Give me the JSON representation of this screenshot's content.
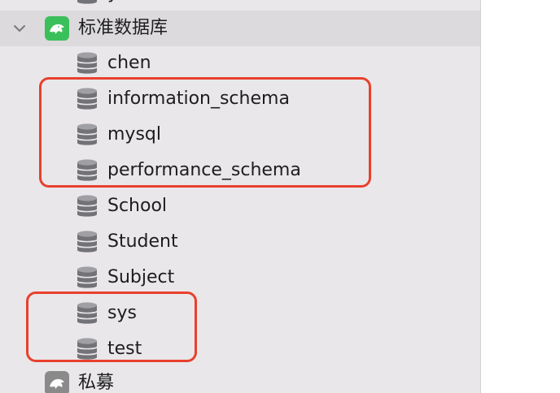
{
  "top_partial_label": "y",
  "connection": {
    "name": "标准数据库",
    "icon": "mysql-dolphin-icon",
    "expanded": true,
    "icon_color": "#3bbf5a"
  },
  "databases": [
    {
      "name": "chen"
    },
    {
      "name": "information_schema"
    },
    {
      "name": "mysql"
    },
    {
      "name": "performance_schema"
    },
    {
      "name": "School"
    },
    {
      "name": "Student"
    },
    {
      "name": "Subject"
    },
    {
      "name": "sys"
    },
    {
      "name": "test"
    }
  ],
  "connection2": {
    "name": "私募",
    "icon": "mysql-dolphin-icon",
    "icon_color": "#8a8a8a"
  },
  "colors": {
    "highlight": "#e8402d",
    "sidebar_bg": "#e9e7ea",
    "selected_row": "#dcdadd"
  }
}
